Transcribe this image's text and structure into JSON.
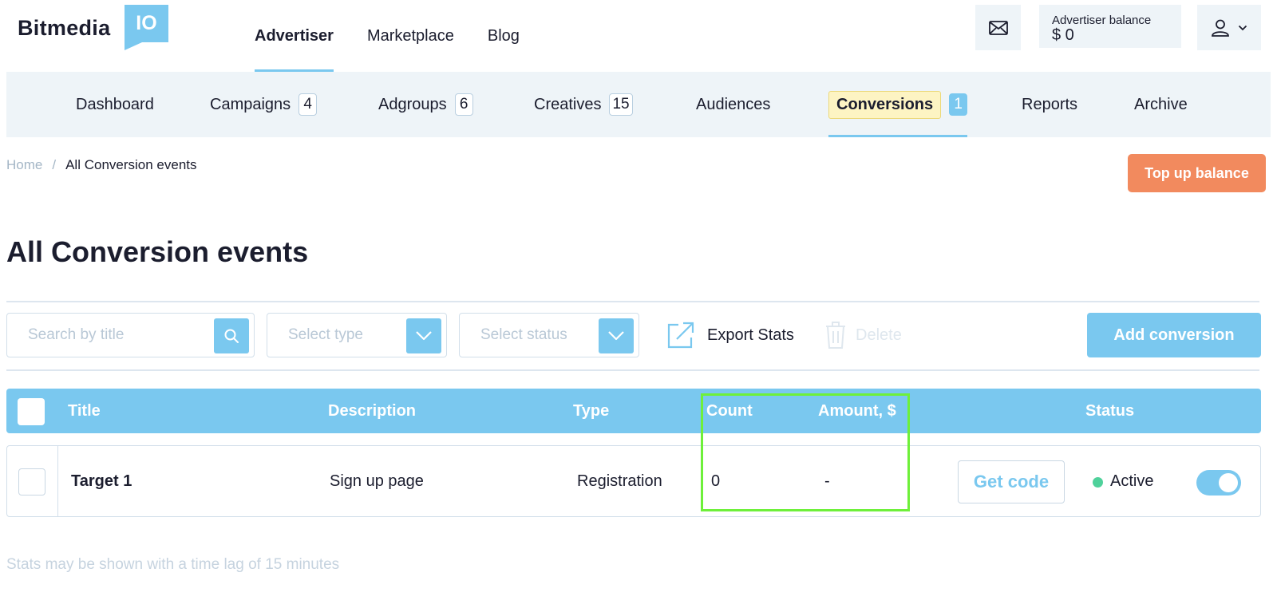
{
  "header": {
    "logo_text": "Bitmedia",
    "logo_badge": "IO",
    "nav": [
      {
        "label": "Advertiser",
        "active": true
      },
      {
        "label": "Marketplace",
        "active": false
      },
      {
        "label": "Blog",
        "active": false
      }
    ],
    "balance_label": "Advertiser balance",
    "balance_value": "$ 0",
    "icons": {
      "mail": "mail-icon",
      "user": "user-icon",
      "dropdown": "chevron-down-icon"
    }
  },
  "subnav": [
    {
      "label": "Dashboard",
      "badge": null
    },
    {
      "label": "Campaigns",
      "badge": "4"
    },
    {
      "label": "Adgroups",
      "badge": "6"
    },
    {
      "label": "Creatives",
      "badge": "15"
    },
    {
      "label": "Audiences",
      "badge": null
    },
    {
      "label": "Conversions",
      "badge": "1",
      "active": true
    },
    {
      "label": "Reports",
      "badge": null
    },
    {
      "label": "Archive",
      "badge": null
    }
  ],
  "breadcrumb": {
    "home": "Home",
    "separator": "/",
    "current": "All Conversion events"
  },
  "topup_label": "Top up balance",
  "page_title": "All Conversion events",
  "toolbar": {
    "search_placeholder": "Search by title",
    "type_placeholder": "Select type",
    "status_placeholder": "Select status",
    "export_label": "Export Stats",
    "delete_label": "Delete",
    "add_label": "Add conversion"
  },
  "table": {
    "headers": {
      "title": "Title",
      "description": "Description",
      "type": "Type",
      "count": "Count",
      "amount": "Amount, $",
      "status": "Status"
    },
    "rows": [
      {
        "title": "Target 1",
        "description": "Sign up page",
        "type": "Registration",
        "count": "0",
        "amount": "-",
        "action": "Get code",
        "status": "Active",
        "enabled": true
      }
    ]
  },
  "note": "Stats may be shown with a time lag of 15 minutes",
  "colors": {
    "accent": "#7ac8ef",
    "topup": "#f28a5e",
    "active_dot": "#4fd19b",
    "highlight": "#6ef03a",
    "active_tab_bg": "#fdf4c3"
  }
}
